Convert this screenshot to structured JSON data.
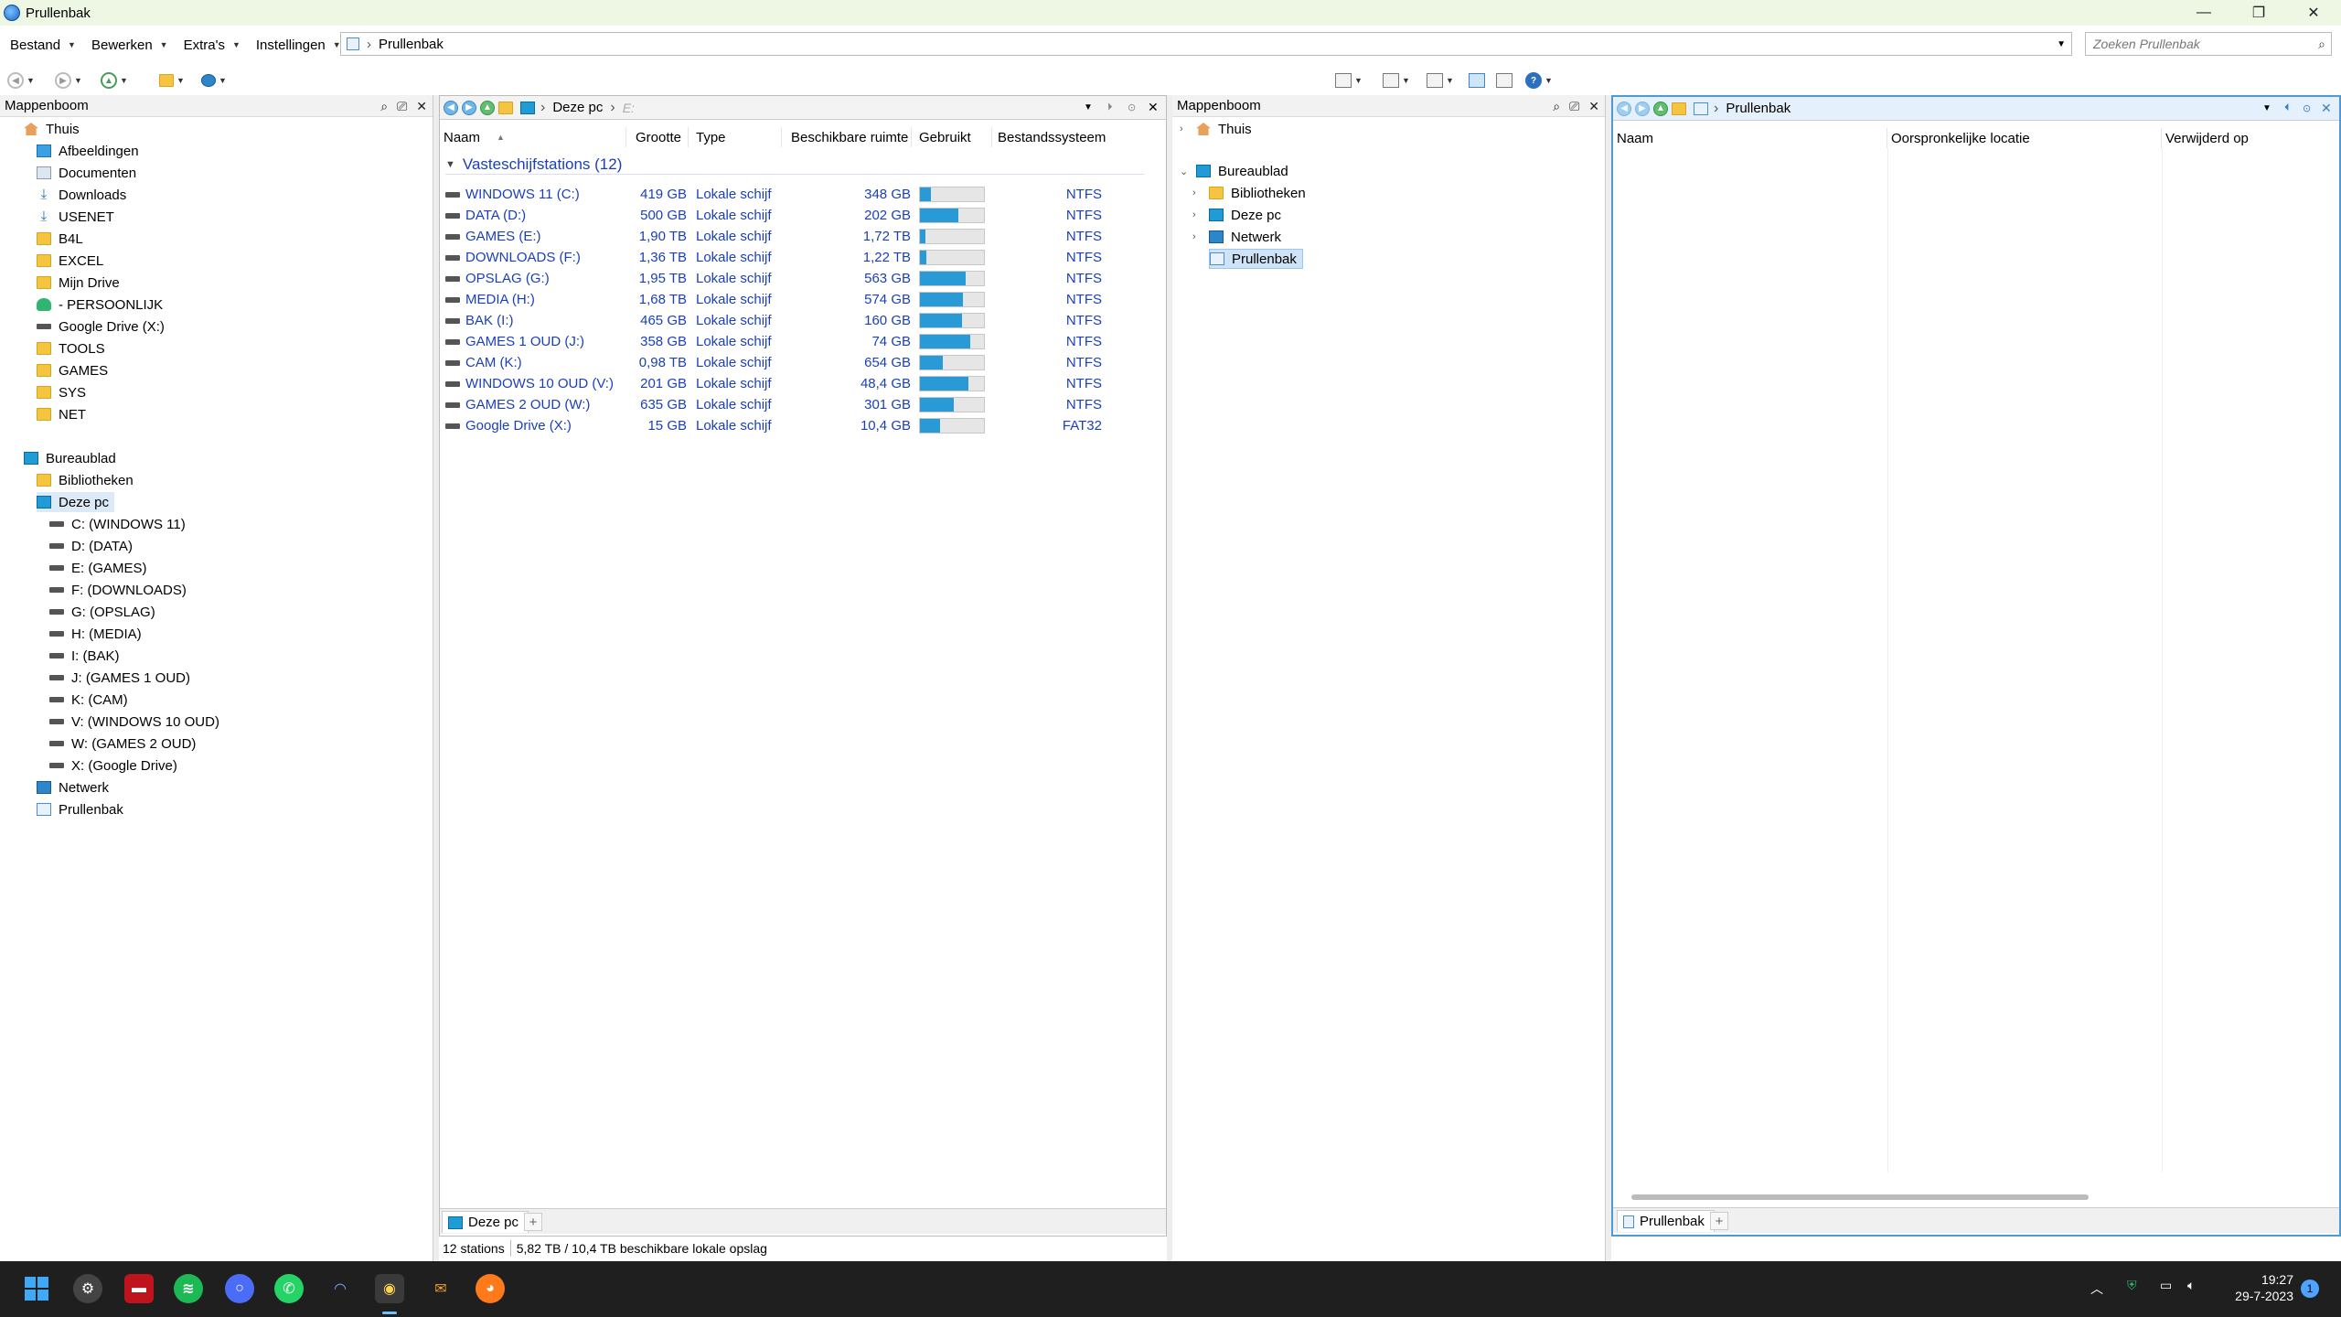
{
  "window": {
    "title": "Prullenbak",
    "minimize": "—",
    "maximize": "❐",
    "close": "✕"
  },
  "menu": {
    "items": [
      "Bestand",
      "Bewerken",
      "Extra's",
      "Instellingen"
    ]
  },
  "address": {
    "path": "Prullenbak"
  },
  "search": {
    "placeholder": "Zoeken Prullenbak"
  },
  "left_tree": {
    "title": "Mappenboom",
    "quick": [
      {
        "label": "Thuis",
        "icon": "home"
      },
      {
        "label": "Afbeeldingen",
        "icon": "pic"
      },
      {
        "label": "Documenten",
        "icon": "doc"
      },
      {
        "label": "Downloads",
        "icon": "dl"
      },
      {
        "label": "USENET",
        "icon": "dl"
      },
      {
        "label": "B4L",
        "icon": "fold"
      },
      {
        "label": "EXCEL",
        "icon": "fold"
      },
      {
        "label": "Mijn Drive",
        "icon": "fold"
      },
      {
        "label": "- PERSOONLIJK",
        "icon": "person"
      },
      {
        "label": "Google Drive (X:)",
        "icon": "drv"
      },
      {
        "label": "TOOLS",
        "icon": "fold"
      },
      {
        "label": "GAMES",
        "icon": "fold"
      },
      {
        "label": "SYS",
        "icon": "fold"
      },
      {
        "label": "NET",
        "icon": "fold"
      }
    ],
    "desktop": [
      {
        "label": "Bureaublad",
        "icon": "mon",
        "indent": 0
      },
      {
        "label": "Bibliotheken",
        "icon": "fold",
        "indent": 1
      },
      {
        "label": "Deze pc",
        "icon": "mon",
        "indent": 1
      },
      {
        "label": "C: (WINDOWS 11)",
        "icon": "drv",
        "indent": 2
      },
      {
        "label": "D: (DATA)",
        "icon": "drv",
        "indent": 2
      },
      {
        "label": "E: (GAMES)",
        "icon": "drv",
        "indent": 2
      },
      {
        "label": "F: (DOWNLOADS)",
        "icon": "drv",
        "indent": 2
      },
      {
        "label": "G: (OPSLAG)",
        "icon": "drv",
        "indent": 2
      },
      {
        "label": "H: (MEDIA)",
        "icon": "drv",
        "indent": 2
      },
      {
        "label": "I: (BAK)",
        "icon": "drv",
        "indent": 2
      },
      {
        "label": "J: (GAMES 1 OUD)",
        "icon": "drv",
        "indent": 2
      },
      {
        "label": "K: (CAM)",
        "icon": "drv",
        "indent": 2
      },
      {
        "label": "V: (WINDOWS 10 OUD)",
        "icon": "drv",
        "indent": 2
      },
      {
        "label": "W: (GAMES 2 OUD)",
        "icon": "drv",
        "indent": 2
      },
      {
        "label": "X: (Google Drive)",
        "icon": "drv",
        "indent": 2
      },
      {
        "label": "Netwerk",
        "icon": "net",
        "indent": 1
      },
      {
        "label": "Prullenbak",
        "icon": "bin",
        "indent": 1
      }
    ]
  },
  "middle": {
    "breadcrumb": [
      "Deze pc",
      "E:"
    ],
    "columns": [
      "Naam",
      "Grootte",
      "Type",
      "Beschikbare ruimte",
      "Gebruikt",
      "Bestandssysteem"
    ],
    "group": "Vasteschijfstations (12)",
    "drives": [
      {
        "name": "WINDOWS 11 (C:)",
        "size": "419 GB",
        "type": "Lokale schijf",
        "free": "348 GB",
        "used": 0.17,
        "fs": "NTFS"
      },
      {
        "name": "DATA (D:)",
        "size": "500 GB",
        "type": "Lokale schijf",
        "free": "202 GB",
        "used": 0.6,
        "fs": "NTFS"
      },
      {
        "name": "GAMES (E:)",
        "size": "1,90 TB",
        "type": "Lokale schijf",
        "free": "1,72 TB",
        "used": 0.09,
        "fs": "NTFS"
      },
      {
        "name": "DOWNLOADS (F:)",
        "size": "1,36 TB",
        "type": "Lokale schijf",
        "free": "1,22 TB",
        "used": 0.1,
        "fs": "NTFS"
      },
      {
        "name": "OPSLAG (G:)",
        "size": "1,95 TB",
        "type": "Lokale schijf",
        "free": "563 GB",
        "used": 0.72,
        "fs": "NTFS"
      },
      {
        "name": "MEDIA (H:)",
        "size": "1,68 TB",
        "type": "Lokale schijf",
        "free": "574 GB",
        "used": 0.67,
        "fs": "NTFS"
      },
      {
        "name": "BAK (I:)",
        "size": "465 GB",
        "type": "Lokale schijf",
        "free": "160 GB",
        "used": 0.66,
        "fs": "NTFS"
      },
      {
        "name": "GAMES 1 OUD (J:)",
        "size": "358 GB",
        "type": "Lokale schijf",
        "free": "74 GB",
        "used": 0.79,
        "fs": "NTFS"
      },
      {
        "name": "CAM (K:)",
        "size": "0,98 TB",
        "type": "Lokale schijf",
        "free": "654 GB",
        "used": 0.35,
        "fs": "NTFS"
      },
      {
        "name": "WINDOWS 10 OUD (V:)",
        "size": "201 GB",
        "type": "Lokale schijf",
        "free": "48,4 GB",
        "used": 0.76,
        "fs": "NTFS"
      },
      {
        "name": "GAMES 2 OUD (W:)",
        "size": "635 GB",
        "type": "Lokale schijf",
        "free": "301 GB",
        "used": 0.53,
        "fs": "NTFS"
      },
      {
        "name": "Google Drive (X:)",
        "size": "15 GB",
        "type": "Lokale schijf",
        "free": "10,4 GB",
        "used": 0.31,
        "fs": "FAT32"
      }
    ],
    "tab": "Deze pc",
    "status_count": "12 stations",
    "status_space": "5,82 TB / 10,4 TB beschikbare lokale opslag"
  },
  "right_tree": {
    "title": "Mappenboom",
    "items": [
      {
        "label": "Thuis",
        "icon": "home",
        "indent": 0
      },
      {
        "label": "Bureaublad",
        "icon": "mon",
        "indent": 0
      },
      {
        "label": "Bibliotheken",
        "icon": "fold",
        "indent": 1
      },
      {
        "label": "Deze pc",
        "icon": "mon",
        "indent": 1
      },
      {
        "label": "Netwerk",
        "icon": "net",
        "indent": 1
      },
      {
        "label": "Prullenbak",
        "icon": "bin",
        "indent": 1
      }
    ]
  },
  "right": {
    "breadcrumb": "Prullenbak",
    "columns": [
      "Naam",
      "Oorspronkelijke locatie",
      "Verwijderd op"
    ],
    "tab": "Prullenbak"
  },
  "taskbar": {
    "time": "19:27",
    "date": "29-7-2023",
    "notif": "1"
  }
}
